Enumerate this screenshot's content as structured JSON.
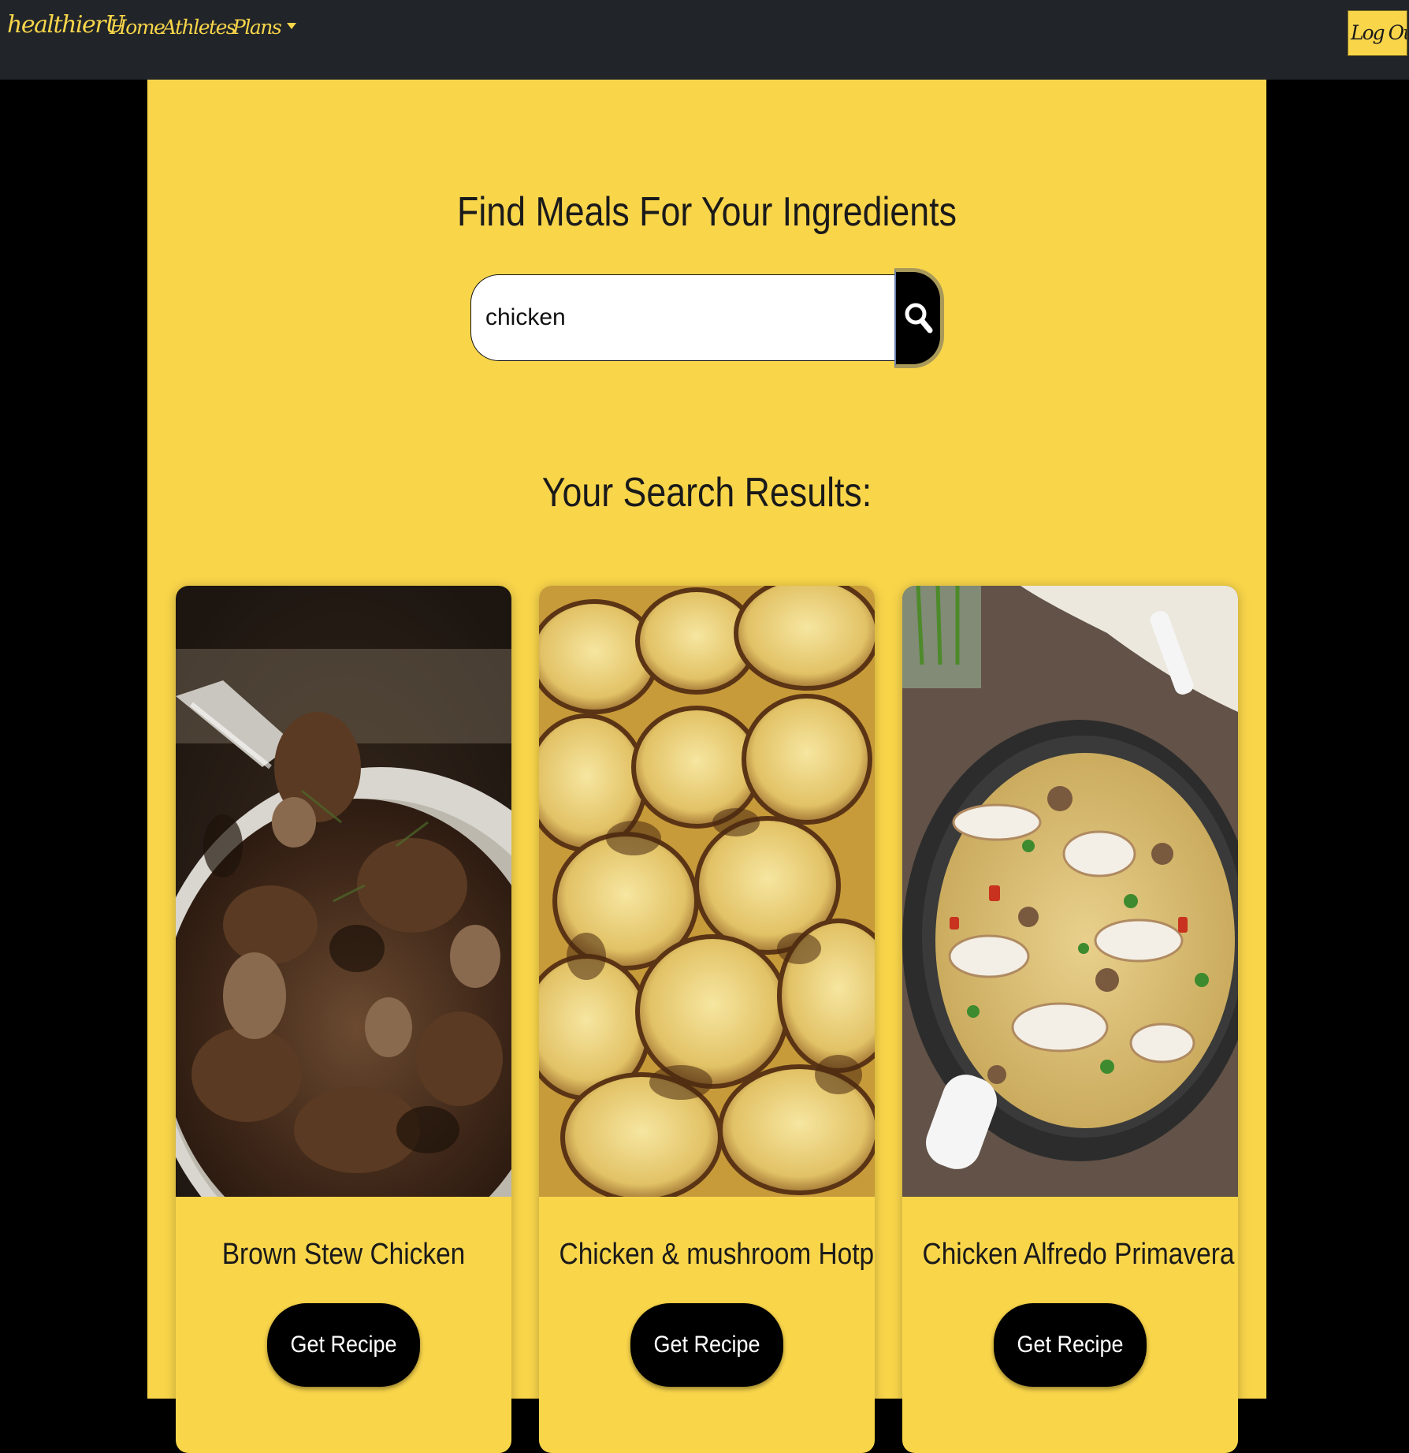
{
  "nav": {
    "brand": "healthierU",
    "links": [
      "Home",
      "Athletes",
      "Plans"
    ],
    "logout_label": "Log Out"
  },
  "main": {
    "heading": "Find Meals For Your Ingredients",
    "search": {
      "value": "chicken",
      "placeholder": ""
    },
    "results_heading": "Your Search Results:",
    "cards": [
      {
        "title": "Brown Stew Chicken",
        "button": "Get Recipe"
      },
      {
        "title": "Chicken & mushroom Hotpot",
        "button": "Get Recipe"
      },
      {
        "title": "Chicken Alfredo Primavera",
        "button": "Get Recipe"
      }
    ]
  },
  "colors": {
    "navbar": "#212529",
    "accent": "#F9D54A",
    "background": "#000000",
    "button": "#000000"
  },
  "icons": [
    "search-icon",
    "caret-down-icon"
  ]
}
